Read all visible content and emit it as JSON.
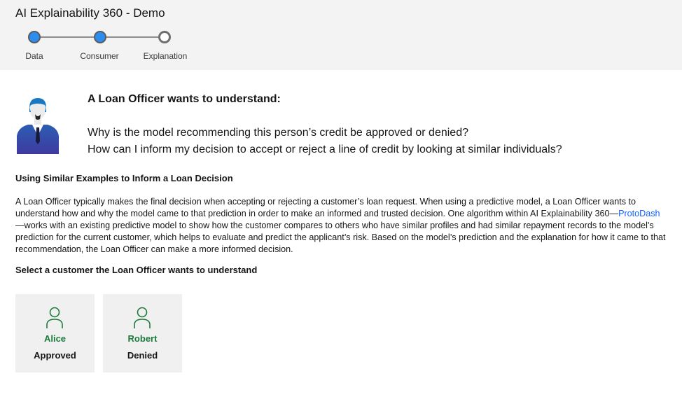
{
  "app": {
    "title": "AI Explainability 360 - Demo"
  },
  "stepper": {
    "steps": [
      {
        "label": "Data",
        "state": "complete"
      },
      {
        "label": "Consumer",
        "state": "complete"
      },
      {
        "label": "Explanation",
        "state": "incomplete"
      }
    ]
  },
  "persona": {
    "icon": "loan-officer-avatar-icon",
    "heading": "A Loan Officer wants to understand:",
    "questions": [
      "Why is the model recommending this person’s credit be approved or denied?",
      "How can I inform my decision to accept or reject a line of credit by looking at similar individuals?"
    ]
  },
  "section": {
    "heading": "Using Similar Examples to Inform a Loan Decision",
    "paragraph_before_link": "A Loan Officer typically makes the final decision when accepting or rejecting a customer’s loan request. When using a predictive model, a Loan Officer wants to understand how and why the model came to that prediction in order to make an informed and trusted decision. One algorithm within AI Explainability 360—",
    "link_text": "ProtoDash",
    "paragraph_after_link": "—works with an existing predictive model to show how the customer compares to others who have similar profiles and had similar repayment records to the model's prediction for the current customer, which helps to evaluate and predict the applicant’s risk. Based on the model’s prediction and the explanation for how it came to that recommendation, the Loan Officer can make a more informed decision."
  },
  "select": {
    "heading": "Select a customer the Loan Officer wants to understand"
  },
  "customers": [
    {
      "name": "Alice",
      "status": "Approved",
      "icon": "person-icon"
    },
    {
      "name": "Robert",
      "status": "Denied",
      "icon": "person-icon"
    }
  ],
  "colors": {
    "step_complete": "#2d8cf0",
    "link": "#0f62fe",
    "customer_name": "#1d7a3c",
    "header_bg": "#f3f3f3",
    "card_bg": "#f0f0f0"
  }
}
